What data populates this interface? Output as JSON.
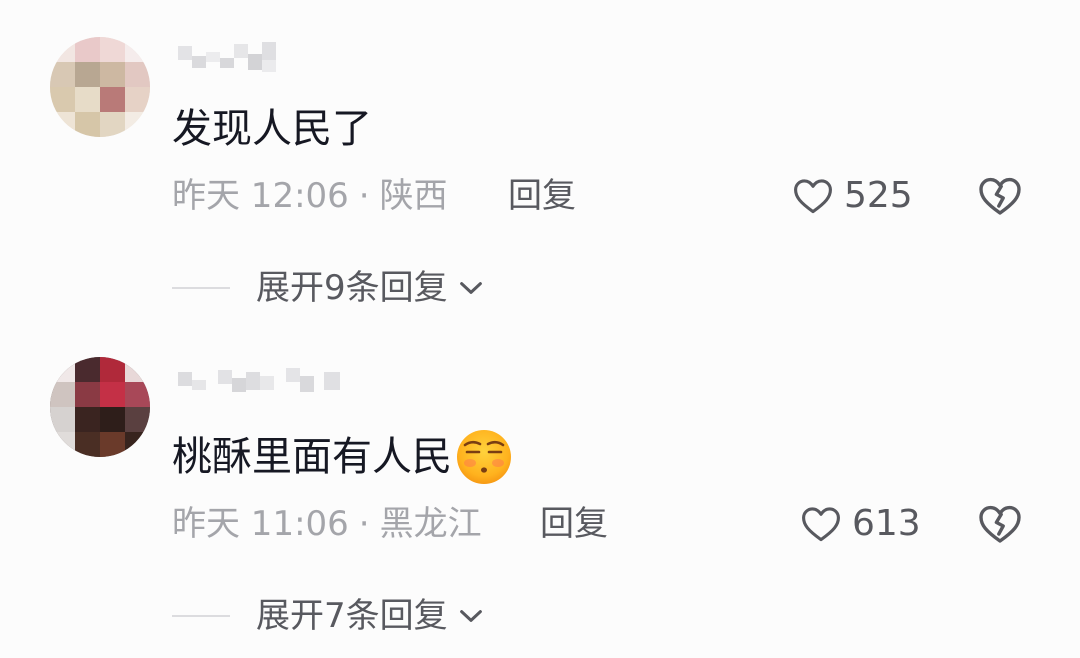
{
  "comments": [
    {
      "text": "发现人民了",
      "time": "昨天 12:06",
      "separator": "·",
      "location": "陕西",
      "reply_label": "回复",
      "likes": "525",
      "expand_label": "展开9条回复"
    },
    {
      "text": "桃酥里面有人民",
      "time": "昨天 11:06",
      "separator": "·",
      "location": "黑龙江",
      "reply_label": "回复",
      "likes": "613",
      "expand_label": "展开7条回复",
      "emoji": "unamused-face-emoji"
    }
  ],
  "icons": {
    "like": "heart-outline-icon",
    "dislike": "broken-heart-icon",
    "expand": "chevron-down-icon"
  },
  "colors": {
    "text": "#161823",
    "meta": "#a4a5aa",
    "action": "#58595f"
  }
}
